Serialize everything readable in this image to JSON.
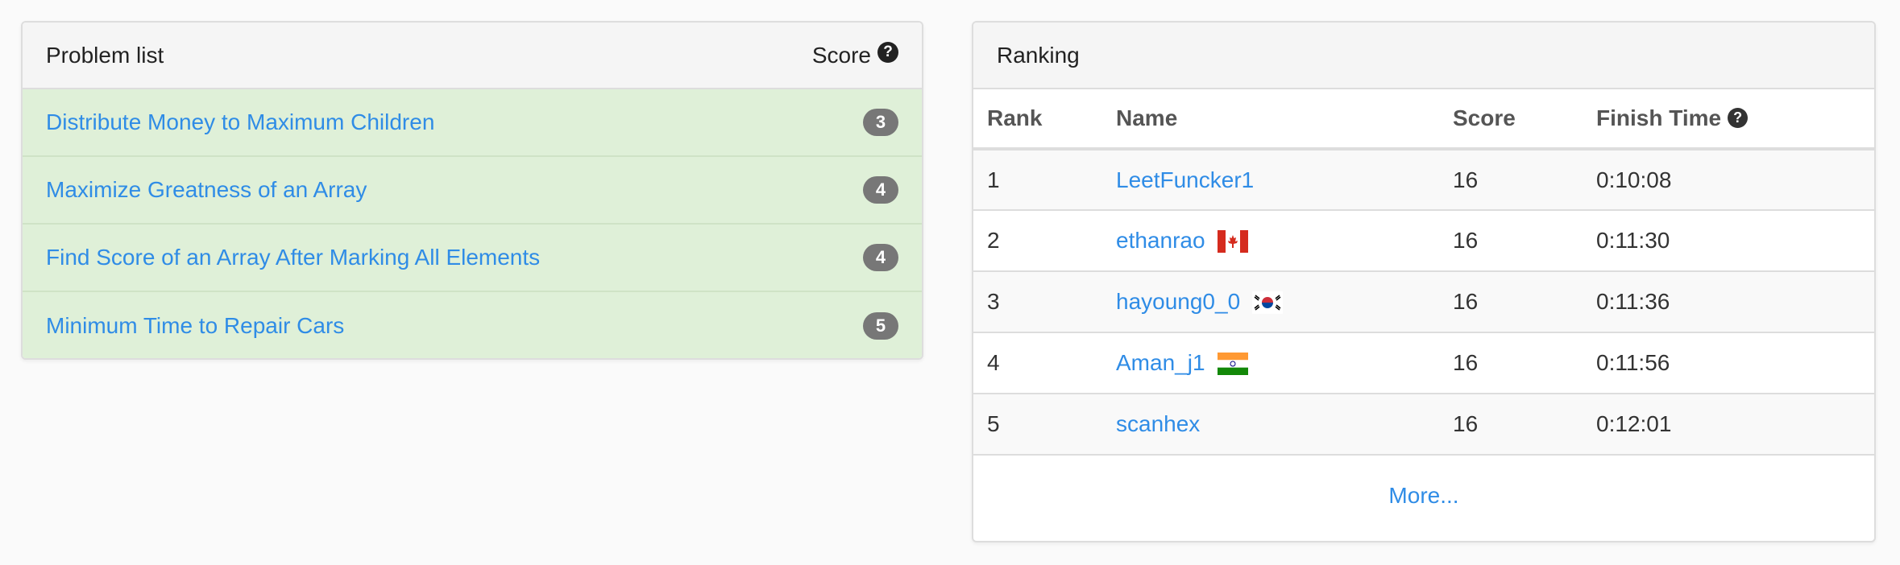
{
  "problems": {
    "title": "Problem list",
    "score_label": "Score",
    "help_glyph": "?",
    "items": [
      {
        "title": "Distribute Money to Maximum Children",
        "score": "3"
      },
      {
        "title": "Maximize Greatness of an Array",
        "score": "4"
      },
      {
        "title": "Find Score of an Array After Marking All Elements",
        "score": "4"
      },
      {
        "title": "Minimum Time to Repair Cars",
        "score": "5"
      }
    ]
  },
  "ranking": {
    "title": "Ranking",
    "columns": {
      "rank": "Rank",
      "name": "Name",
      "score": "Score",
      "finish_time": "Finish Time"
    },
    "help_glyph": "?",
    "rows": [
      {
        "rank": "1",
        "name": "LeetFuncker1",
        "score": "16",
        "finish_time": "0:10:08",
        "flag": null
      },
      {
        "rank": "2",
        "name": "ethanrao",
        "score": "16",
        "finish_time": "0:11:30",
        "flag": "canada-flag-icon"
      },
      {
        "rank": "3",
        "name": "hayoung0_0",
        "score": "16",
        "finish_time": "0:11:36",
        "flag": "south-korea-flag-icon"
      },
      {
        "rank": "4",
        "name": "Aman_j1",
        "score": "16",
        "finish_time": "0:11:56",
        "flag": "india-flag-icon"
      },
      {
        "rank": "5",
        "name": "scanhex",
        "score": "16",
        "finish_time": "0:12:01",
        "flag": null
      }
    ],
    "more_label": "More..."
  },
  "colors": {
    "link": "#2f8ce6",
    "accepted_row": "#dff0d8",
    "badge": "#777777",
    "panel_heading": "#f5f5f5"
  }
}
